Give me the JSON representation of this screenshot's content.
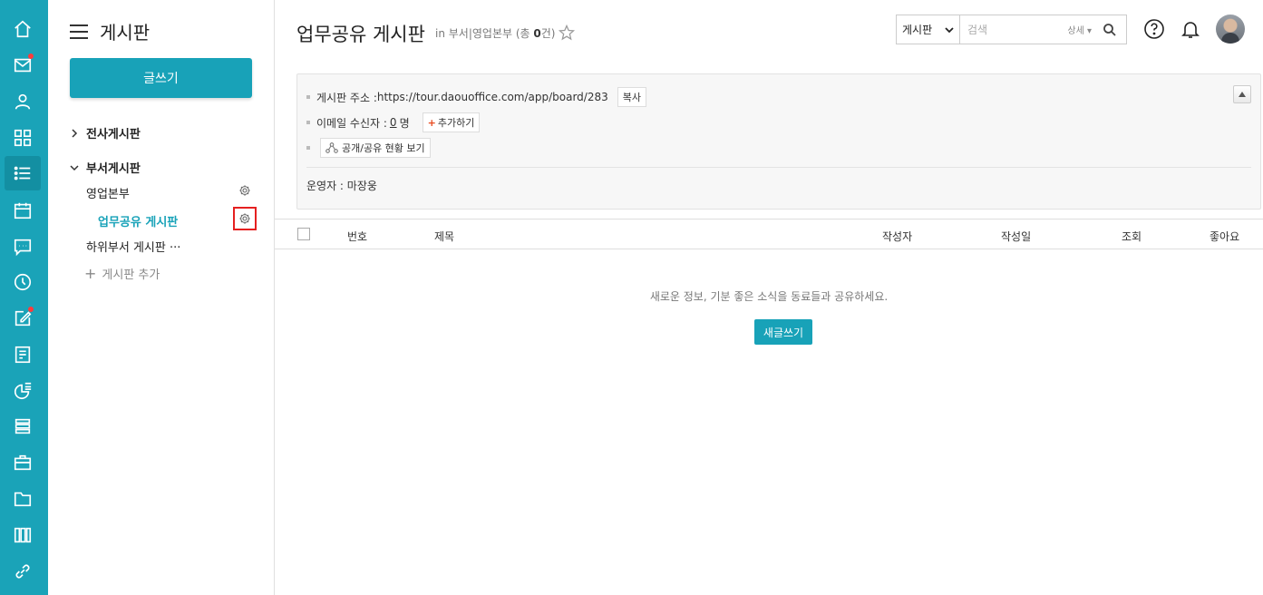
{
  "rail": {
    "items": [
      {
        "icon": "home-icon"
      },
      {
        "icon": "mail-icon",
        "notify": true
      },
      {
        "icon": "contacts-icon"
      },
      {
        "icon": "apps-grid-icon"
      },
      {
        "icon": "board-list-icon",
        "active": true
      },
      {
        "icon": "calendar-icon"
      },
      {
        "icon": "chat-icon"
      },
      {
        "icon": "clock-icon"
      },
      {
        "icon": "edit-note-icon",
        "notify": true
      },
      {
        "icon": "report-icon"
      },
      {
        "icon": "survey-chart-icon"
      },
      {
        "icon": "docs-stack-icon"
      },
      {
        "icon": "briefcase-icon"
      },
      {
        "icon": "folder-icon"
      },
      {
        "icon": "library-icon"
      },
      {
        "icon": "link-icon"
      }
    ]
  },
  "sidebar": {
    "title": "게시판",
    "write_label": "글쓰기",
    "company_board": "전사게시판",
    "dept_board": "부서게시판",
    "dept_name": "영업본부",
    "current_board": "업무공유 게시판",
    "sub_board": "하위부서 게시판 ···",
    "add_board": "게시판 추가"
  },
  "header": {
    "title": "업무공유 게시판",
    "sub_prefix": "in 부서|영업본부 (총 ",
    "sub_count": "0",
    "sub_suffix": "건)",
    "search_scope": "게시판",
    "search_placeholder": "검색",
    "search_detail": "상세 ▾"
  },
  "info": {
    "address_label": "게시판 주소 :",
    "address_url": "https://tour.daouoffice.com/app/board/283",
    "copy_label": "복사",
    "email_label": "이메일 수신자 :",
    "email_count": "0",
    "email_unit": "명",
    "add_label": "추가하기",
    "share_label": "공개/공유 현황 보기",
    "owner": "운영자 : 마장웅"
  },
  "table": {
    "columns": [
      "번호",
      "제목",
      "작성자",
      "작성일",
      "조회",
      "좋아요"
    ],
    "empty_message": "새로운 정보, 기분 좋은 소식을 동료들과 공유하세요.",
    "new_write_label": "새글쓰기"
  },
  "colors": {
    "brand": "#18a2b8",
    "rail_active": "#138fa2",
    "notify": "#ff3b3b",
    "highlight": "#e52020"
  }
}
